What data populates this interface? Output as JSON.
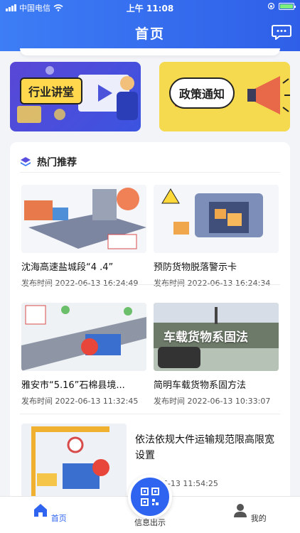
{
  "status_bar": {
    "carrier": "中国电信",
    "time": "上午 11:08"
  },
  "header": {
    "title": "首页"
  },
  "banners": [
    {
      "label": "行业讲堂"
    },
    {
      "label": "政策通知"
    }
  ],
  "hot": {
    "title": "热门推荐",
    "items": [
      {
        "title": "沈海高速盐城段“4 .4”",
        "meta": "发布时间  2022-06-13 16:24:49"
      },
      {
        "title": "预防货物脱落警示卡",
        "meta": "发布时间  2022-06-13 16:24:34"
      },
      {
        "title": "雅安市“5.16”石棉县境...",
        "meta": "发布时间  2022-06-13 11:32:45"
      },
      {
        "title": "简明车载货物系固方法",
        "meta": "发布时间  2022-06-13 10:33:07",
        "thumb_text": "车载货物系固法"
      }
    ],
    "wide_item": {
      "title": "依法依规大件运输规范限高限宽设置",
      "meta": "2022-06-13 11:54:25"
    }
  },
  "tabbar": {
    "items": [
      {
        "label": "首页"
      },
      {
        "label": "信息出示"
      },
      {
        "label": "我的"
      }
    ]
  },
  "colors": {
    "primary": "#2f64f0",
    "banner_yellow": "#f5d94e"
  }
}
